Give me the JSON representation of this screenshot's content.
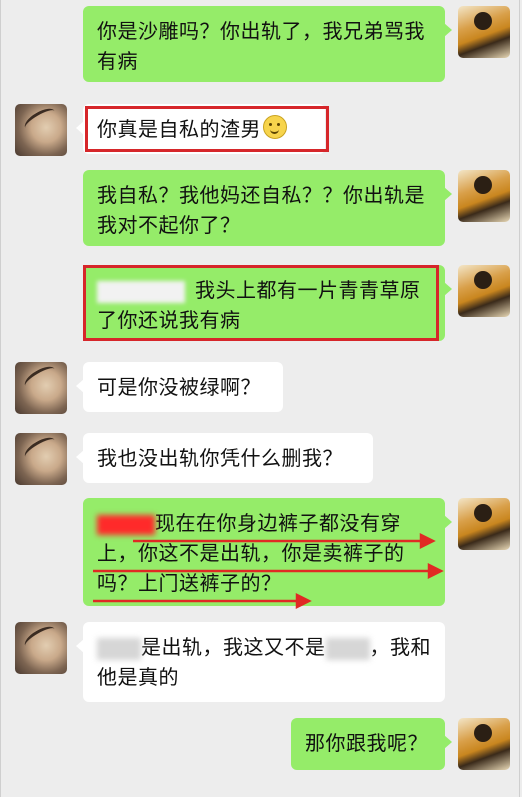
{
  "chat": {
    "messages": [
      {
        "from": "self",
        "text": "你是沙雕吗？你出轨了，我兄弟骂我有病"
      },
      {
        "from": "other",
        "text": "你真是自私的渣男",
        "emoji": "smile-emoji"
      },
      {
        "from": "self",
        "text": "我自私？我他妈还自私？？你出轨是我对不起你了？"
      },
      {
        "from": "self",
        "text": "我头上都有一片青青草原了你还说我有病"
      },
      {
        "from": "other",
        "text": "可是你没被绿啊？"
      },
      {
        "from": "other",
        "text": "我也没出轨你凭什么删我？"
      },
      {
        "from": "self",
        "text_a": "现在在你身边裤子都没有穿",
        "text_b": "上，你这不是出轨，你是卖裤子的吗？上门送裤子的？"
      },
      {
        "from": "other",
        "text_a": "是出轨，我这又不是",
        "text_b": "，我和他是真的"
      },
      {
        "from": "self",
        "text": "那你跟我呢？"
      }
    ]
  },
  "colors": {
    "self_bubble": "#95ec69",
    "other_bubble": "#ffffff",
    "highlight": "#d6262a",
    "background": "#ededed"
  }
}
